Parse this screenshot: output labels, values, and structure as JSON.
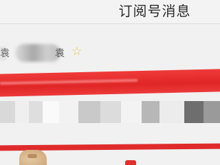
{
  "header": {
    "title": "订阅号消息"
  },
  "account": {
    "prefix_char": "袁",
    "name_suffix_char": "袁",
    "star_icon": "star-icon"
  },
  "colors": {
    "accent_red": "#e02626",
    "star_yellow": "#e5c34a"
  }
}
